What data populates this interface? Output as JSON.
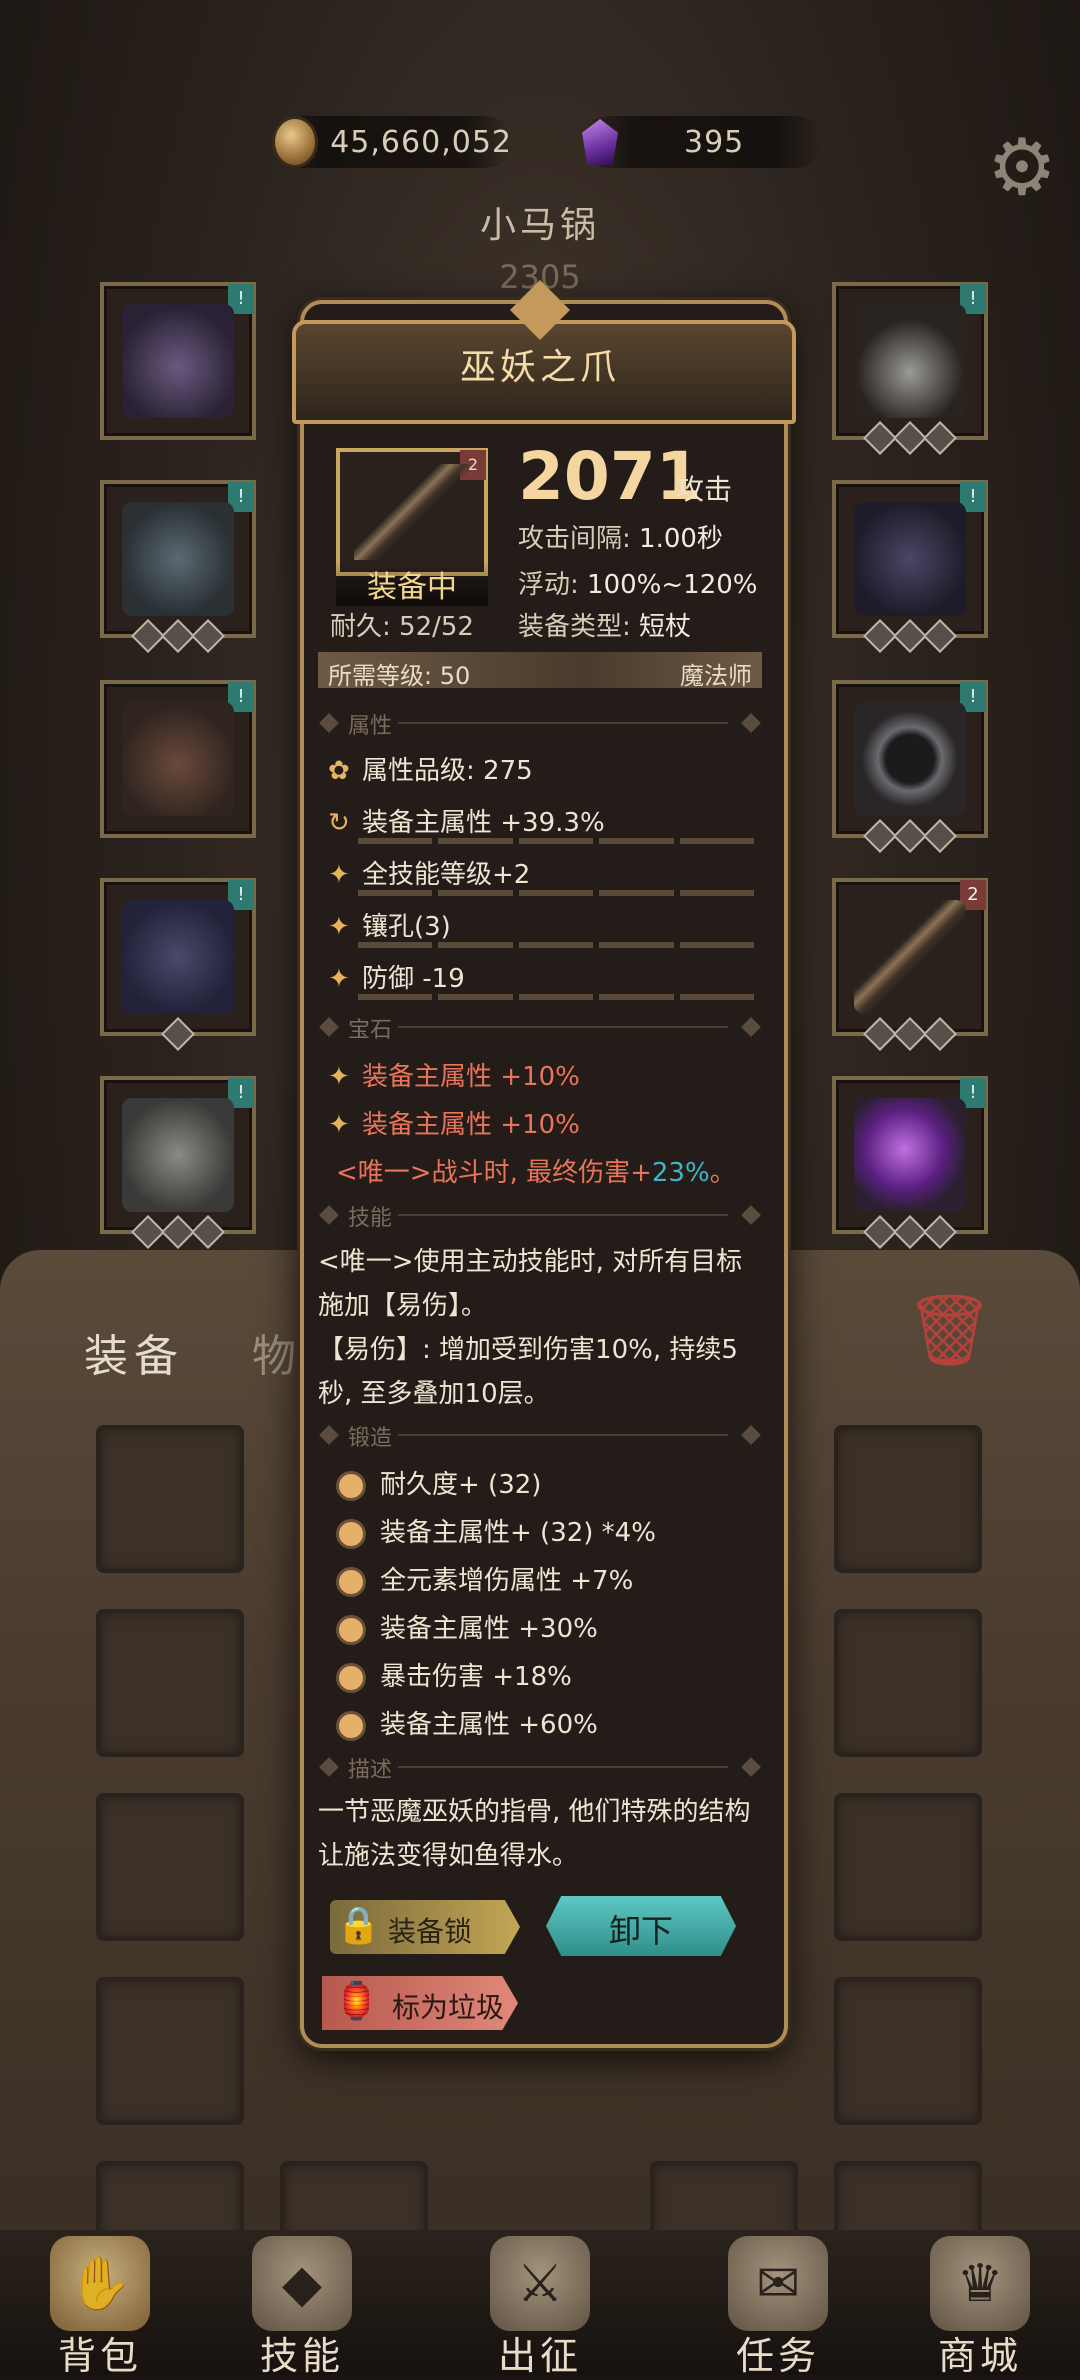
{
  "resources": {
    "gold": "45,660,052",
    "gems": "395"
  },
  "player": {
    "name": "小马锅",
    "level": "2305"
  },
  "tabs": {
    "equipment": "装备",
    "items": "物品"
  },
  "item": {
    "name": "巫妖之爪",
    "tag": "2",
    "equipped": "装备中",
    "durability": "耐久: 52/52",
    "attack": "2071",
    "attack_unit": "攻击",
    "attack_interval_label": "攻击间隔:",
    "attack_interval": "1.00秒",
    "float_label": "浮动:",
    "float": "100%~120%",
    "type_label": "装备类型:",
    "type": "短杖",
    "req_level": "所需等级: 50",
    "req_class": "魔法师"
  },
  "sections": {
    "attributes": "属性",
    "gems": "宝石",
    "skills": "技能",
    "forge": "锻造",
    "description": "描述"
  },
  "attributes": [
    {
      "icon": "✿",
      "text": "属性品级: 275"
    },
    {
      "icon": "↻",
      "text": "装备主属性 +39.3%"
    },
    {
      "icon": "✦",
      "text": "全技能等级+2"
    },
    {
      "icon": "✦",
      "text": "镶孔(3)"
    },
    {
      "icon": "✦",
      "text": "防御 -19"
    }
  ],
  "gem_lines": [
    {
      "icon": "✦",
      "text": "装备主属性 +10%"
    },
    {
      "icon": "✦",
      "text": "装备主属性 +10%"
    }
  ],
  "unique": {
    "prefix": "<唯一>战斗时, 最终伤害+",
    "value": "23%",
    "suffix": "。"
  },
  "skill_text": "<唯一>使用主动技能时, 对所有目标施加【易伤】。",
  "skill_note": "【易伤】: 增加受到伤害10%, 持续5秒, 至多叠加10层。",
  "forge": [
    "耐久度+ (32)",
    "装备主属性+ (32) *4%",
    "全元素增伤属性 +7%",
    "装备主属性 +30%",
    "暴击伤害 +18%",
    "装备主属性 +60%"
  ],
  "description": "一节恶魔巫妖的指骨, 他们特殊的结构让施法变得如鱼得水。",
  "buttons": {
    "lock": "装备锁",
    "unequip": "卸下",
    "trash": "标为垃圾"
  },
  "nav": [
    {
      "label": "背包",
      "icon": "✋"
    },
    {
      "label": "技能",
      "icon": "◆"
    },
    {
      "label": "出征",
      "icon": "⚔"
    },
    {
      "label": "任务",
      "icon": "✉"
    },
    {
      "label": "商城",
      "icon": "♛"
    }
  ],
  "colors": {
    "accent": "#f5d6a0",
    "unique_value": "#3fb6c8",
    "unequip": "#4bb7b2"
  }
}
